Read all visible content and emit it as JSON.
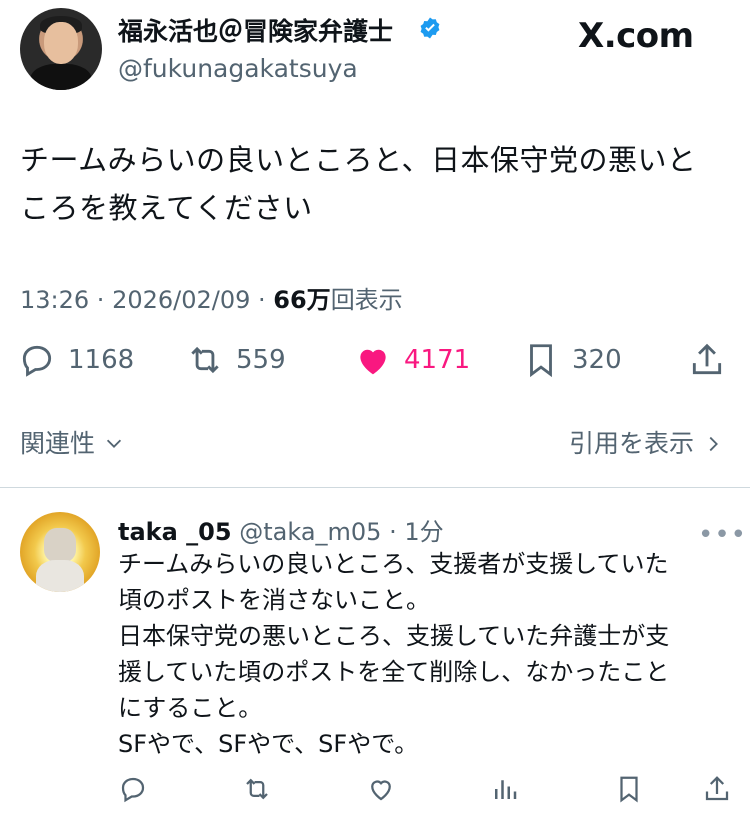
{
  "brand": {
    "logo_text": "X.com",
    "like_color": "#f91880",
    "verified_color": "#1d9bf0"
  },
  "tweet": {
    "author_name": "福永活也＠冒険家弁護士",
    "handle": "@fukunagakatsuya",
    "text": "チームみらいの良いところと、日本保守党の悪いと\nころを教えてください",
    "time": "13:26",
    "date": "2026/02/09",
    "views_count": "66万",
    "views_label": "回表示",
    "replies": "1168",
    "reposts": "559",
    "likes": "4171",
    "bookmarks": "320",
    "related_label": "関連性",
    "quotes_label": "引用を表示"
  },
  "reply": {
    "author_name": "taka _05",
    "handle": "@taka_m05",
    "time": "1分",
    "text": "チームみらいの良いところ、支援者が支援していた\n頃のポストを消さないこと。\n日本保守党の悪いところ、支援していた弁護士が支\n援していた頃のポストを全て削除し、なかったこと\nにすること。\nSFやで、SFやで、SFやで。"
  },
  "icons": [
    "verified-icon",
    "reply-icon",
    "repost-icon",
    "like-icon",
    "bookmark-icon",
    "share-icon",
    "chevron-down-icon",
    "chevron-right-icon",
    "more-icon",
    "views-icon"
  ]
}
